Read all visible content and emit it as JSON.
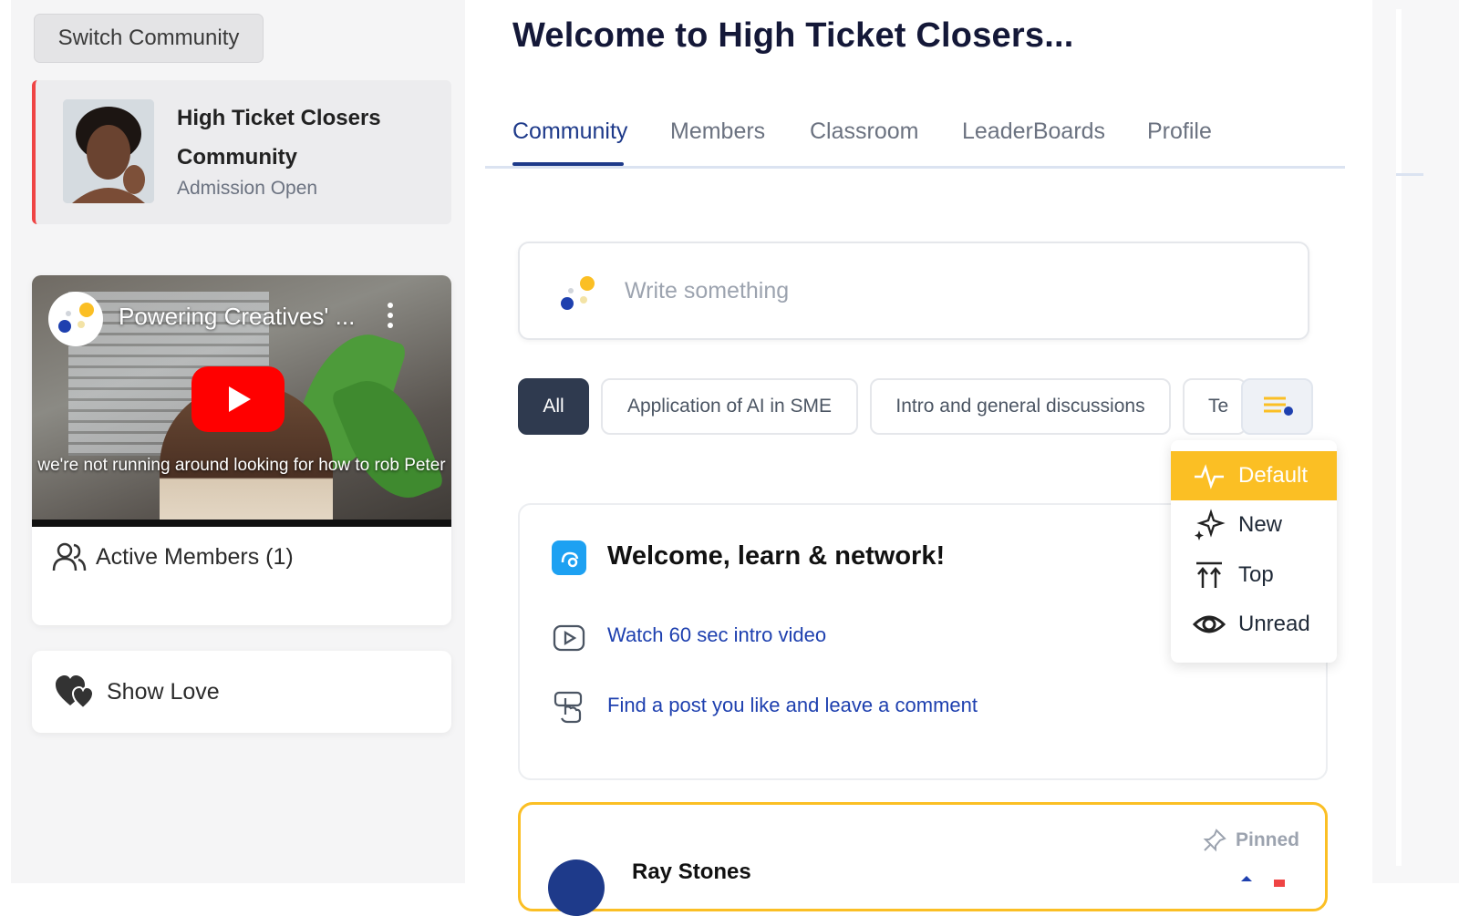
{
  "sidebar": {
    "switch_label": "Switch Community",
    "community": {
      "name": "High Ticket Closers Community",
      "status": "Admission Open"
    },
    "video": {
      "title": "Powering Creatives' ...",
      "caption": "we're not running around looking for how to rob Peter"
    },
    "active_members_label": "Active Members (1)",
    "show_love_label": "Show Love"
  },
  "header": {
    "title": "Welcome to High Ticket Closers..."
  },
  "tabs": [
    {
      "label": "Community",
      "active": true
    },
    {
      "label": "Members"
    },
    {
      "label": "Classroom"
    },
    {
      "label": "LeaderBoards"
    },
    {
      "label": "Profile"
    }
  ],
  "composer": {
    "placeholder": "Write something"
  },
  "filters": {
    "chips": [
      "All",
      "Application of AI in SME",
      "Intro and general discussions",
      "Te"
    ],
    "selected": "All"
  },
  "sort_menu": {
    "items": [
      "Default",
      "New",
      "Top",
      "Unread"
    ],
    "selected": "Default"
  },
  "welcome_card": {
    "heading": "Welcome, learn & network!",
    "links": [
      "Watch 60 sec intro video",
      "Find a post you like and leave a comment"
    ]
  },
  "pinned_post": {
    "badge": "Pinned",
    "author": "Ray Stones"
  },
  "colors": {
    "accent_navy": "#1e3a8a",
    "accent_yellow": "#fbbf24",
    "chip_active_bg": "#2f3a4f",
    "community_border": "#ef4444"
  }
}
